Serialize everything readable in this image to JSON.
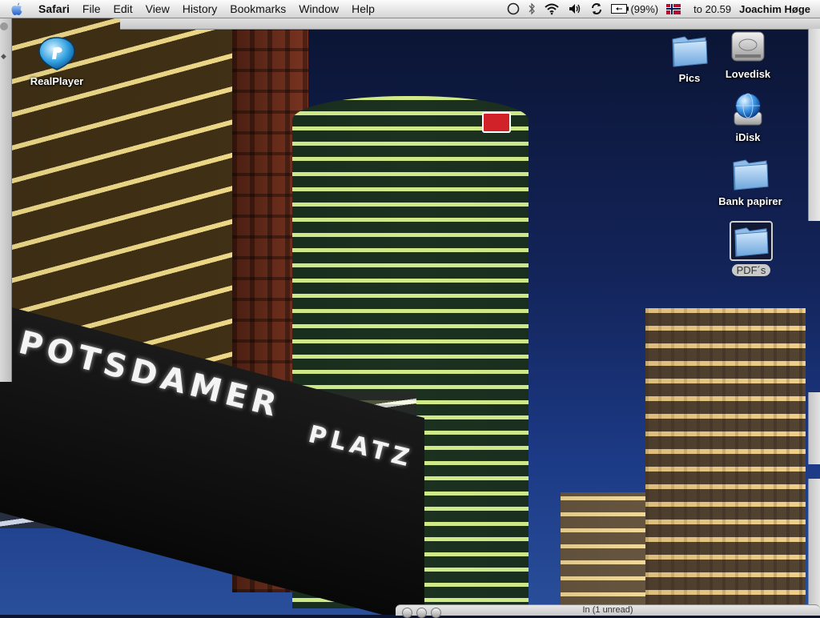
{
  "menubar": {
    "app_name": "Safari",
    "items": [
      "File",
      "Edit",
      "View",
      "History",
      "Bookmarks",
      "Window",
      "Help"
    ],
    "battery_text": "(99%)",
    "clock": "to 20.59",
    "user": "Joachim Høge",
    "icons": [
      "apple-icon",
      "sync-circle-icon",
      "bluetooth-icon",
      "wifi-icon",
      "volume-icon",
      "sync-icon",
      "battery-icon",
      "norway-flag-icon"
    ]
  },
  "wallpaper": {
    "sign_line_1": "POTSDAMER",
    "sign_line_2": "PLATZ"
  },
  "desktop_icons": {
    "realplayer": "RealPlayer",
    "pics": "Pics",
    "lovedisk": "Lovedisk",
    "idisk": "iDisk",
    "bank": "Bank papirer",
    "pdfs": "PDF´s"
  },
  "bottom_window": {
    "title": "In (1 unread)"
  }
}
